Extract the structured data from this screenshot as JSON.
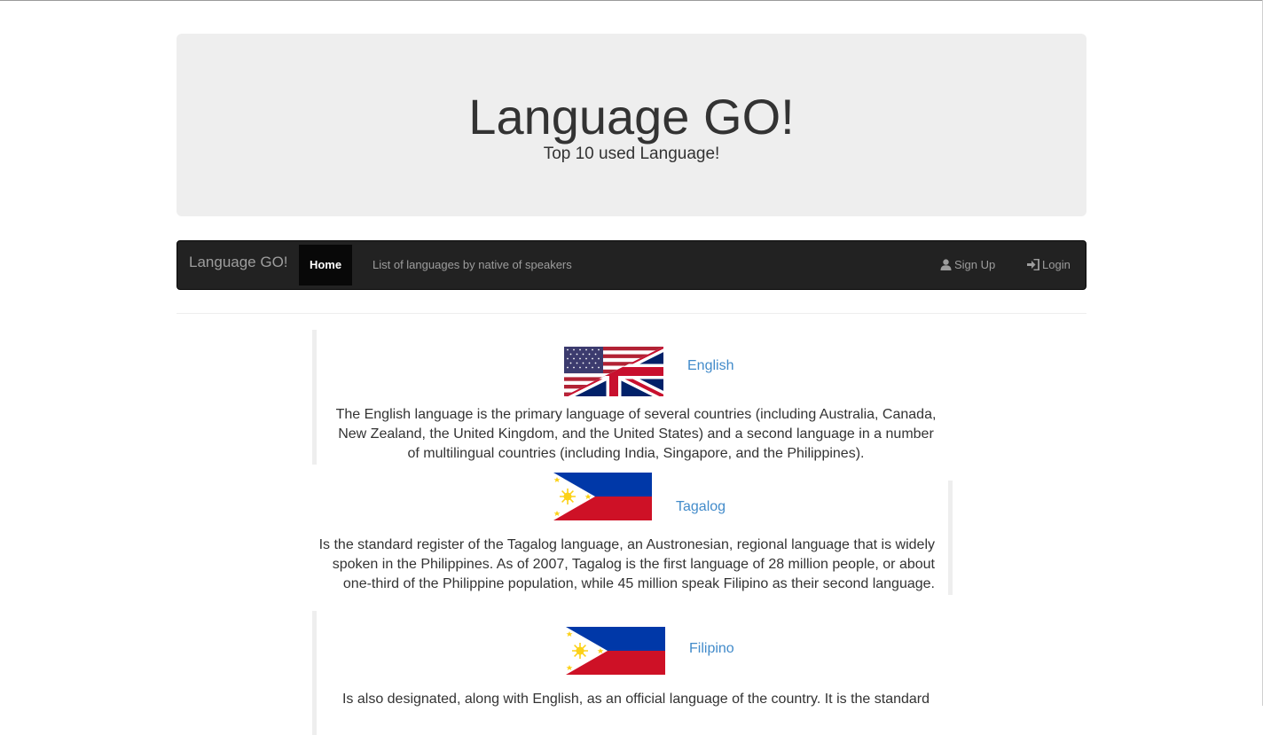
{
  "header": {
    "title": "Language GO!",
    "tagline": "Top 10 used Language!"
  },
  "navbar": {
    "brand": "Language GO!",
    "home": "Home",
    "list_link": "List of languages by native of speakers",
    "signup": "Sign Up",
    "login": "Login",
    "icons": {
      "signup": "user-icon",
      "login": "log-in-icon"
    }
  },
  "languages": [
    {
      "name": "English",
      "flag": "us-uk-flag",
      "description": "The English language is the primary language of several countries (including Australia, Canada, New Zealand, the United Kingdom, and the United States) and a second language in a number of multilingual countries (including India, Singapore, and the Philippines)."
    },
    {
      "name": "Tagalog",
      "flag": "philippines-flag",
      "description": "Is the standard register of the Tagalog language, an Austronesian, regional language that is widely spoken in the Philippines. As of 2007, Tagalog is the first language of 28 million people, or about one-third of the Philippine population, while 45 million speak Filipino as their second language."
    },
    {
      "name": "Filipino",
      "flag": "philippines-flag",
      "description": "Is also designated, along with English, as an official language of the country. It is the standard"
    }
  ],
  "colors": {
    "jumbotron_bg": "#eeeeee",
    "navbar_bg": "#222222",
    "navbar_active_bg": "#080808",
    "navbar_text": "#9d9d9d",
    "link": "#428bca",
    "text": "#333333",
    "blockquote_border": "#eeeeee"
  }
}
